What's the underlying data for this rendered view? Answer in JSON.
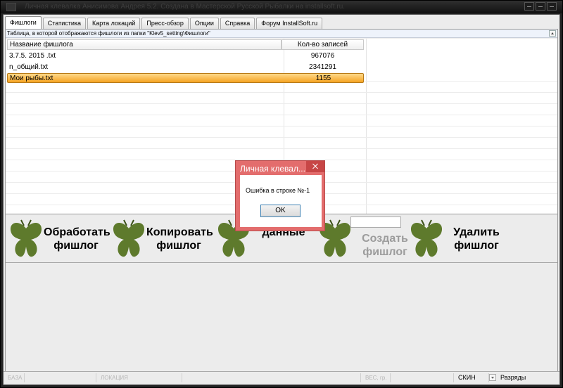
{
  "window": {
    "title": "Личная клевалка Анисимова Андрея 5.2. Создана в Мастерской Русской Рыбалки на installsoft.ru."
  },
  "tabs": [
    {
      "label": "Фишлоги",
      "active": true
    },
    {
      "label": "Статистика",
      "active": false
    },
    {
      "label": "Карта локаций",
      "active": false
    },
    {
      "label": "Пресс-обзор",
      "active": false
    },
    {
      "label": "Опции",
      "active": false
    },
    {
      "label": "Справка",
      "active": false
    },
    {
      "label": "Форум InstallSoft.ru",
      "active": false
    }
  ],
  "table": {
    "caption": "Таблица, в которой отображаются фишлоги из папки \"Klev5_setting\\Фишлоги\"",
    "columns": [
      "Название фишлога",
      "Кол-во записей"
    ],
    "rows": [
      {
        "name": "3.7.5. 2015 .txt",
        "count": "967076",
        "selected": false
      },
      {
        "name": "n_общий.txt",
        "count": "2341291",
        "selected": false
      },
      {
        "name": "Мои рыбы.txt",
        "count": "1155",
        "selected": true
      }
    ]
  },
  "actions": {
    "process": {
      "line1": "Обработать",
      "line2": "фишлог",
      "icon": "butterfly-icon"
    },
    "copy": {
      "line1": "Копировать",
      "line2": "фишлог",
      "icon": "butterfly-icon"
    },
    "data": {
      "line1": "",
      "line2": "данные",
      "icon": "butterfly-icon"
    },
    "create": {
      "line1": "Создать",
      "line2": "фишлог",
      "icon": "butterfly-icon",
      "disabled": true
    },
    "delete": {
      "line1": "Удалить",
      "line2": "фишлог",
      "icon": "butterfly-icon"
    }
  },
  "statusbar": {
    "base": "БАЗА",
    "location": "ЛОКАЦИЯ",
    "weight": "ВЕС, гр.",
    "skin": "СКИН",
    "ranks": "Разряды"
  },
  "dialog": {
    "title": "Личная клевал...",
    "message": "Ошибка в строке №-1",
    "ok": "OK"
  },
  "colors": {
    "selection": "#f5a423",
    "butterfly": "#5e7a2c",
    "dialog_frame": "#e36d6d"
  }
}
